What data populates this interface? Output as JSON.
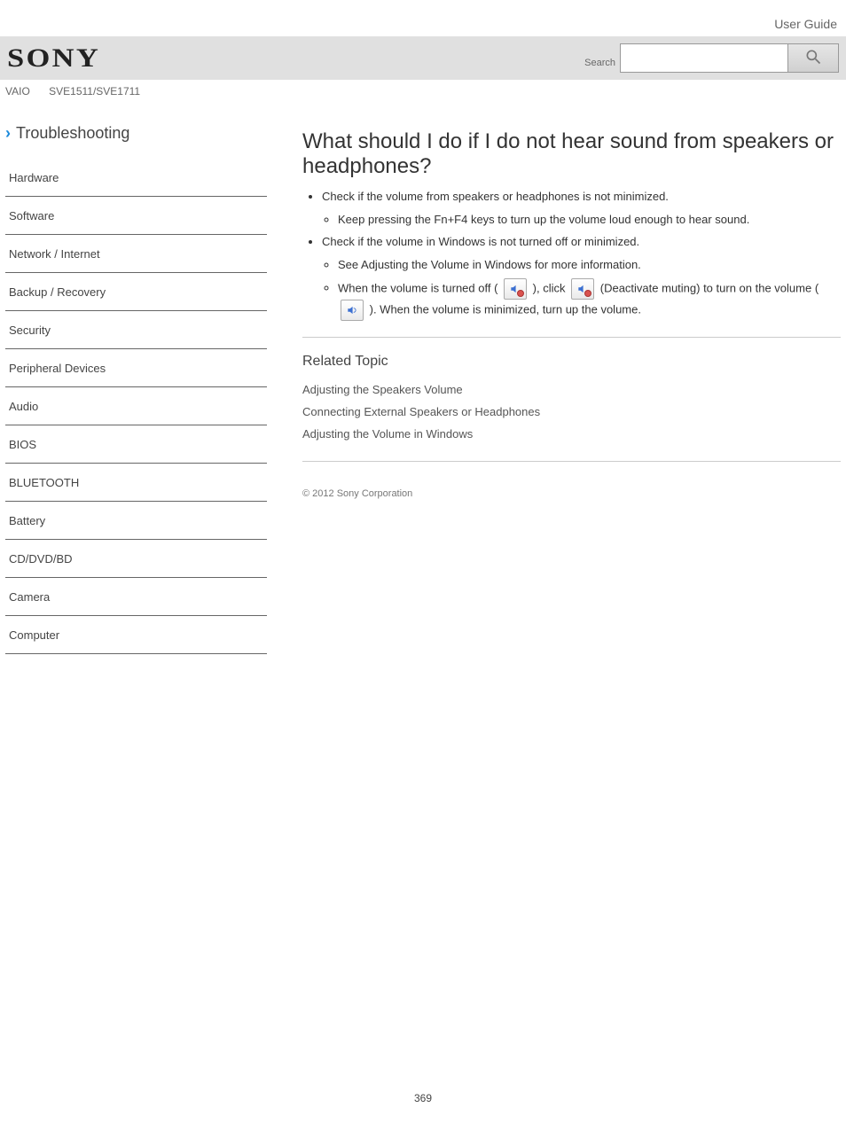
{
  "header": {
    "logo": "SONY",
    "guide_title": "User Guide",
    "search_label": "Search",
    "search_placeholder": ""
  },
  "model": {
    "brand": "VAIO",
    "series": "SVE1511/SVE1711"
  },
  "sidebar": {
    "heading": "Troubleshooting",
    "items": [
      "Hardware",
      "Software",
      "Network / Internet",
      "Backup / Recovery",
      "Security",
      "Peripheral Devices",
      "Audio",
      "BIOS",
      "BLUETOOTH",
      "Battery",
      "CD/DVD/BD",
      "Camera",
      "Computer"
    ]
  },
  "article": {
    "title": "What should I do if I do not hear sound from speakers or headphones?",
    "bullets": [
      {
        "t": "Check if the volume from speakers or headphones is not minimized."
      },
      {
        "t": "Keep pressing the Fn+F4 keys to turn up the volume loud enough to hear sound."
      },
      {
        "t": "Check if the volume in Windows is not turned off or minimized."
      },
      {
        "t": "See Adjusting the Volume in Windows for more information."
      },
      {
        "t_before": "When the volume is turned off (",
        "icon1": "mute",
        "t_mid": "), click ",
        "icon2": "mute",
        "t_after": " (Deactivate muting) to turn on the volume "
      },
      {
        "t_before": "(",
        "icon1": "vol",
        "t_after": "). When the volume is minimized, turn up the volume."
      }
    ]
  },
  "related": {
    "heading": "Related Topic",
    "items": [
      "Adjusting the Speakers Volume",
      "Connecting External Speakers or Headphones",
      "Adjusting the Volume in Windows"
    ]
  },
  "footer": {
    "copyright": "© 2012 Sony Corporation",
    "page_number": "369"
  }
}
